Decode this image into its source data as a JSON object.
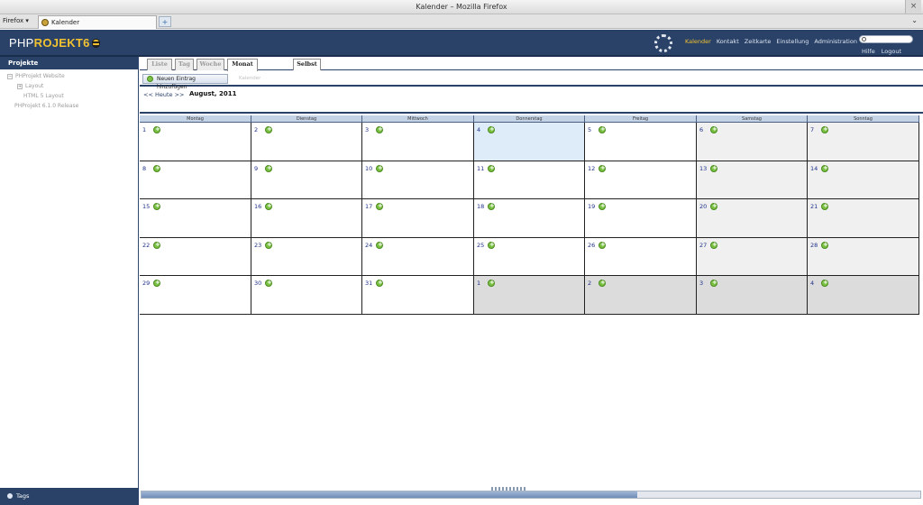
{
  "window": {
    "title": "Kalender – Mozilla Firefox",
    "close_glyph": "×"
  },
  "browser": {
    "menu_label": "Firefox",
    "tab_label": "Kalender",
    "newtab_glyph": "+",
    "tablist_glyph": "⌄"
  },
  "app": {
    "logo_part1": "PHP",
    "logo_part2": "ROJEKT6",
    "nav": [
      "Kalender",
      "Kontakt",
      "Zeitkarte",
      "Einstellung",
      "Administration"
    ],
    "active_nav": "Kalender",
    "user_nav": [
      "Hilfe",
      "Logout"
    ],
    "accent_color": "#f2c230",
    "header_color": "#2a4268"
  },
  "sidebar": {
    "title": "Projekte",
    "tree": [
      {
        "label": "PHProjekt Website",
        "toggle": "−"
      },
      {
        "label": "Layout",
        "toggle": "+"
      },
      {
        "label": "HTML 5 Layout",
        "toggle": ""
      },
      {
        "label": "PHProjekt 6.1.0 Release",
        "toggle": ""
      }
    ],
    "footer_label": "Tags"
  },
  "calendar": {
    "view_tabs": [
      "Liste",
      "Tag",
      "Woche",
      "Monat"
    ],
    "active_view": "Monat",
    "self_tab": "Selbst",
    "add_button": "Neuen Eintrag hinzufügen",
    "toolbar_label": "Kalender",
    "nav_prev": "<< Heute >>",
    "month_label": "August, 2011",
    "weekdays": [
      "Montag",
      "Dienstag",
      "Mittwoch",
      "Donnerstag",
      "Freitag",
      "Samstag",
      "Sonntag"
    ],
    "weeks": [
      [
        "1",
        "2",
        "3",
        "4",
        "5",
        "6",
        "7"
      ],
      [
        "8",
        "9",
        "10",
        "11",
        "12",
        "13",
        "14"
      ],
      [
        "15",
        "16",
        "17",
        "18",
        "19",
        "20",
        "21"
      ],
      [
        "22",
        "23",
        "24",
        "25",
        "26",
        "27",
        "28"
      ],
      [
        "29",
        "30",
        "31",
        "1",
        "2",
        "3",
        "4"
      ]
    ],
    "today": "4"
  }
}
